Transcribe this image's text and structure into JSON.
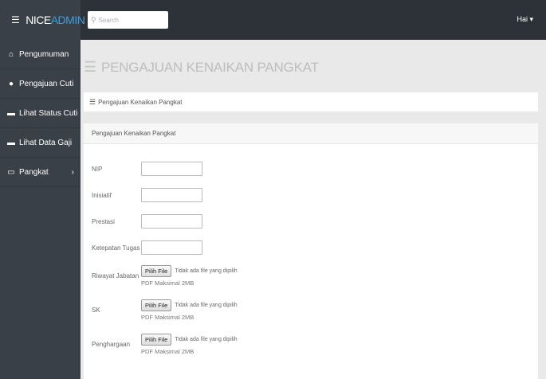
{
  "brand": {
    "menu_icon": "hamburger-icon",
    "part1": "NICE",
    "part2": "ADMIN"
  },
  "colors": {
    "topbar": "#2d3238",
    "sidebar": "#3a4048",
    "brand_accent": "#3c9ddb",
    "content_bg": "#e9e9e9"
  },
  "search": {
    "placeholder": "Search",
    "icon": "search-icon"
  },
  "user_menu": {
    "label": "Hai ▾"
  },
  "sidebar": {
    "items": [
      {
        "label": "Pengumuman",
        "icon": "home-icon"
      },
      {
        "label": "Pengajuan Cuti",
        "icon": "circle-icon"
      },
      {
        "label": "Lihat Status Cuti",
        "icon": "dash-icon"
      },
      {
        "label": "Lihat Data Gaji",
        "icon": "dash-icon"
      },
      {
        "label": "Pangkat",
        "icon": "monitor-icon",
        "chevron": "›"
      }
    ]
  },
  "page": {
    "title": "PENGAJUAN KENAIKAN PANGKAT",
    "title_icon": "list-icon"
  },
  "breadcrumb": {
    "label": "Pengajuan Kenaikan Pangkat",
    "icon": "list-icon"
  },
  "panel": {
    "heading": "Pengajuan Kenaikan Pangkat",
    "text_fields": [
      {
        "label": "NIP",
        "value": ""
      },
      {
        "label": "Inisiatif",
        "value": ""
      },
      {
        "label": "Prestasi",
        "value": ""
      },
      {
        "label": "Ketepatan Tugas",
        "value": ""
      }
    ],
    "file_fields": [
      {
        "label": "Riwayat Jabatan",
        "button": "Pilih File",
        "status": "Tidak ada file yang dipilih",
        "hint": "PDF Maksimal 2MB"
      },
      {
        "label": "SK",
        "button": "Pilih File",
        "status": "Tidak ada file yang dipilih",
        "hint": "PDF Maksimal 2MB"
      },
      {
        "label": "Penghargaan",
        "button": "Pilih File",
        "status": "Tidak ada file yang dipilih",
        "hint": "PDF Maksimal 2MB"
      }
    ]
  }
}
